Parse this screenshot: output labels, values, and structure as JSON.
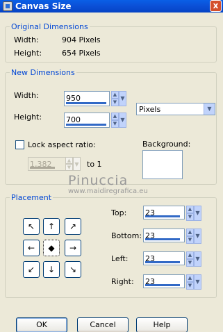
{
  "window": {
    "title": "Canvas Size",
    "close_glyph": "x"
  },
  "original": {
    "legend": "Original Dimensions",
    "width_label": "Width:",
    "width_value": "904 Pixels",
    "height_label": "Height:",
    "height_value": "654 Pixels"
  },
  "new_dims": {
    "legend": "New Dimensions",
    "width_label": "Width:",
    "width_value": "950",
    "height_label": "Height:",
    "height_value": "700",
    "units": "Pixels",
    "lock_label": "Lock aspect ratio:",
    "lock_checked": false,
    "ratio_value": "1,382",
    "ratio_suffix": "to 1",
    "background_label": "Background:",
    "background_color": "#ffffff"
  },
  "placement": {
    "legend": "Placement",
    "top_label": "Top:",
    "top_value": "23",
    "bottom_label": "Bottom:",
    "bottom_value": "23",
    "left_label": "Left:",
    "left_value": "23",
    "right_label": "Right:",
    "right_value": "23",
    "selected": "center",
    "arrow_icons": [
      "arrow-up-left",
      "arrow-up",
      "arrow-up-right",
      "arrow-left",
      "center-dot",
      "arrow-right",
      "arrow-down-left",
      "arrow-down",
      "arrow-down-right"
    ]
  },
  "buttons": {
    "ok": "OK",
    "cancel": "Cancel",
    "help": "Help"
  },
  "watermark": {
    "line1": "Pinuccia",
    "line2": "www.maidiregrafica.eu"
  },
  "colors": {
    "titlebar": "#0b4fd6",
    "legend": "#0046d5",
    "face": "#ece9d8",
    "accent_bar": "#3169c6"
  }
}
